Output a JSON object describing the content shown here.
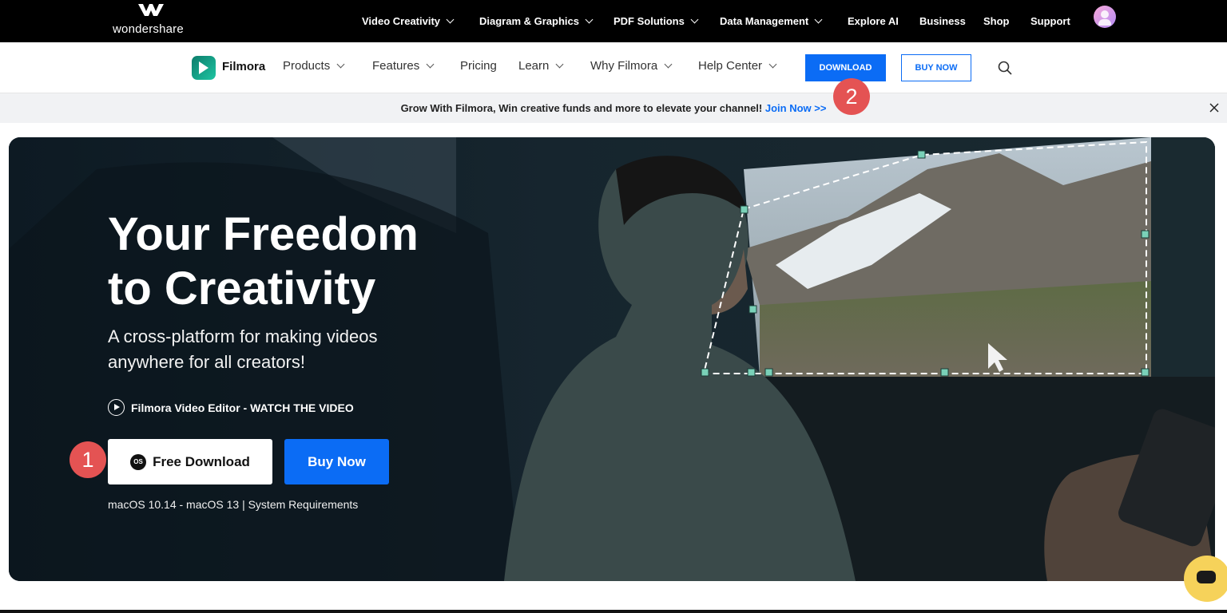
{
  "brand": {
    "company": "wondershare",
    "product": "Filmora"
  },
  "top_nav": {
    "items": [
      {
        "label": "Video Creativity",
        "dropdown": true
      },
      {
        "label": "Diagram & Graphics",
        "dropdown": true
      },
      {
        "label": "PDF Solutions",
        "dropdown": true
      },
      {
        "label": "Data Management",
        "dropdown": true
      },
      {
        "label": "Explore AI",
        "dropdown": false
      },
      {
        "label": "Business",
        "dropdown": false
      },
      {
        "label": "Shop",
        "dropdown": false
      },
      {
        "label": "Support",
        "dropdown": false
      }
    ]
  },
  "sub_nav": {
    "items": [
      {
        "label": "Products",
        "dropdown": true
      },
      {
        "label": "Features",
        "dropdown": true
      },
      {
        "label": "Pricing",
        "dropdown": false
      },
      {
        "label": "Learn",
        "dropdown": true
      },
      {
        "label": "Why Filmora",
        "dropdown": true
      },
      {
        "label": "Help Center",
        "dropdown": true
      }
    ],
    "download_label": "DOWNLOAD",
    "buy_label": "BUY NOW"
  },
  "banner": {
    "text": "Grow With Filmora, Win creative funds and more to elevate your channel! ",
    "link": "Join Now >>"
  },
  "hero": {
    "title": "Your Freedom\nto Creativity",
    "subtitle": "A cross-platform for making videos anywhere for all creators!",
    "watch_label": "Filmora Video Editor - WATCH THE VIDEO",
    "free_download_label": "Free Download",
    "os_icon_label": "OS",
    "buy_label": "Buy Now",
    "requirements": "macOS 10.14 - macOS 13 | System Requirements"
  },
  "markers": {
    "first": "1",
    "second": "2"
  },
  "colors": {
    "accent": "#0b6cf5",
    "marker": "#e45353",
    "topbar": "#000000"
  }
}
